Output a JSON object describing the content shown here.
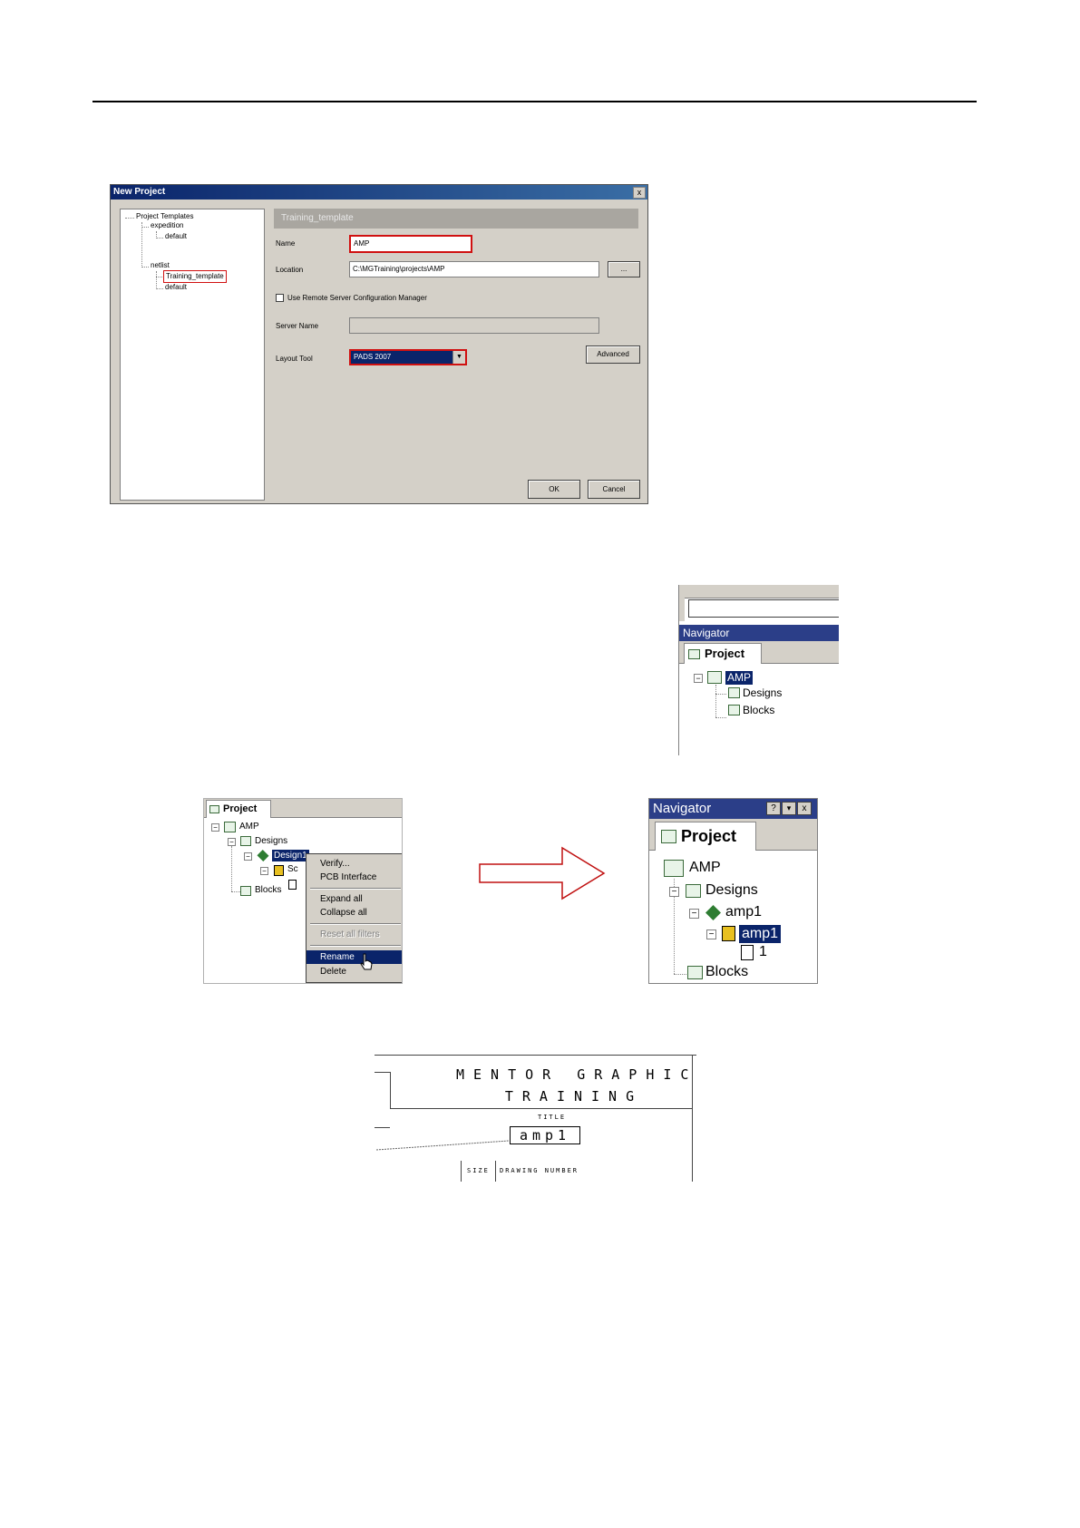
{
  "dialog": {
    "title": "New Project",
    "close_label": "x",
    "tree": {
      "root": "Project Templates",
      "groups": [
        {
          "name": "expedition",
          "children": [
            "default"
          ]
        },
        {
          "name": "netlist",
          "children": [
            "Training_template",
            "default"
          ]
        }
      ]
    },
    "template_header": "Training_template",
    "name_label": "Name",
    "name_value": "AMP",
    "location_label": "Location",
    "location_value": "C:\\MGTraining\\projects\\AMP",
    "browse_label": "...",
    "remote_checkbox_label": "Use Remote Server Configuration Manager",
    "server_name_label": "Server Name",
    "server_name_value": "",
    "layout_tool_label": "Layout Tool",
    "layout_tool_value": "PADS 2007",
    "advanced_label": "Advanced",
    "ok_label": "OK",
    "cancel_label": "Cancel"
  },
  "navigator_small": {
    "title": "Navigator",
    "tab": "Project",
    "tree": {
      "root": "AMP",
      "children": [
        "Designs",
        "Blocks"
      ]
    }
  },
  "context_panel": {
    "tab": "Project",
    "tree": {
      "root": "AMP",
      "designs": "Designs",
      "design": "Design1",
      "schematic": "Sc",
      "blocks": "Blocks"
    },
    "menu_items": [
      "Verify...",
      "PCB Interface",
      "Expand all",
      "Collapse all",
      "Reset all filters",
      "Rename",
      "Delete"
    ],
    "highlighted_item": "Rename"
  },
  "navigator_large": {
    "title": "Navigator",
    "title_buttons": [
      "?",
      "▾",
      "x"
    ],
    "tab": "Project",
    "tree": {
      "root": "AMP",
      "designs": "Designs",
      "design": "amp1",
      "schematic": "amp1",
      "sheet": "1",
      "blocks": "Blocks"
    }
  },
  "title_block": {
    "company_line1": "MENTOR GRAPHICS",
    "company_line2": "TRAINING",
    "title_label": "TITLE",
    "title_value": "amp1",
    "size_label": "SIZE",
    "drawing_number_label": "DRAWING NUMBER"
  },
  "colors": {
    "highlight_red": "#d01010",
    "selection_blue": "#0a246a",
    "dialog_gray": "#d4d0c8",
    "arrow_red": "#c01010"
  }
}
